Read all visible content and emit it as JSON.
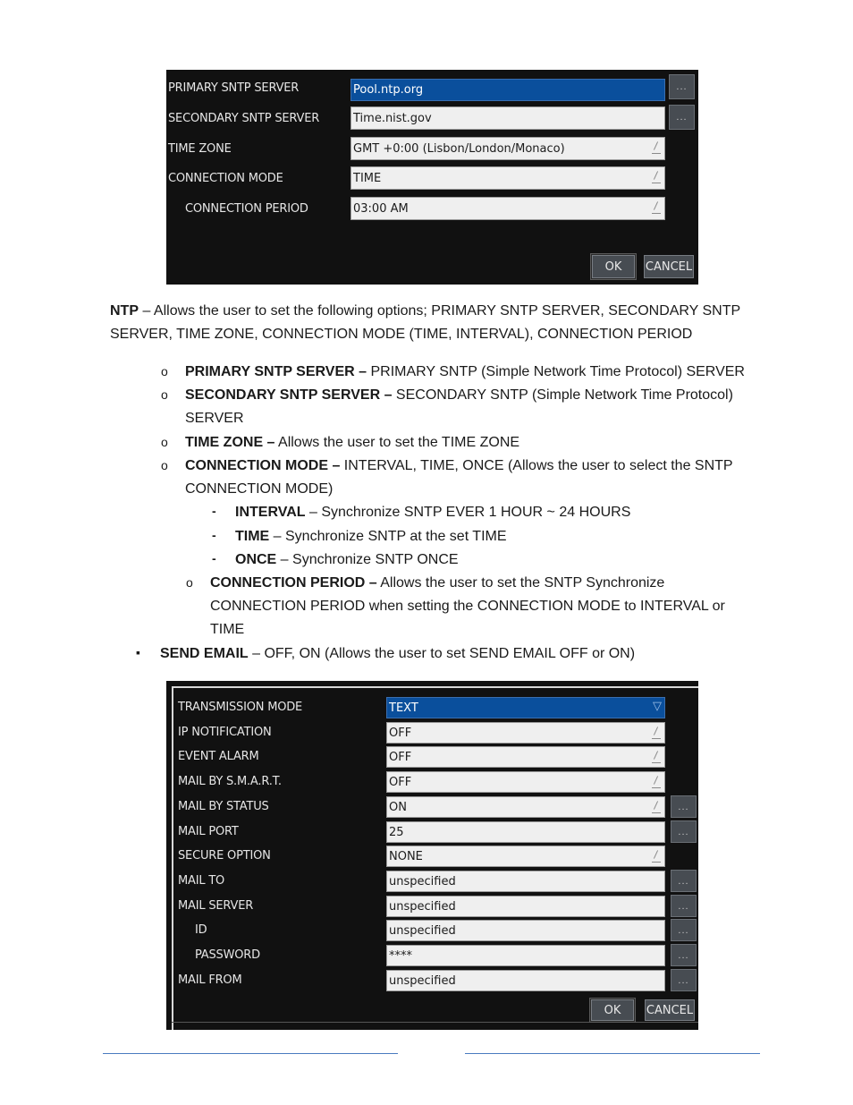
{
  "ntp_panel": {
    "rows": [
      {
        "label": "PRIMARY SNTP SERVER",
        "value": "Pool.ntp.org",
        "selected": true,
        "has_browse": true,
        "editable_mark": false
      },
      {
        "label": "SECONDARY SNTP SERVER",
        "value": "Time.nist.gov",
        "selected": false,
        "has_browse": true,
        "editable_mark": false
      },
      {
        "label": "TIME ZONE",
        "value": "GMT +0:00 (Lisbon/London/Monaco)",
        "selected": false,
        "has_browse": false,
        "editable_mark": true
      },
      {
        "label": "CONNECTION MODE",
        "value": "TIME",
        "selected": false,
        "has_browse": false,
        "editable_mark": true
      },
      {
        "label": "CONNECTION PERIOD",
        "value": "03:00 AM",
        "selected": false,
        "has_browse": false,
        "editable_mark": true
      }
    ],
    "browse_label": "...",
    "ok_label": "OK",
    "cancel_label": "CANCEL"
  },
  "description": {
    "ntp_term": "NTP",
    "ntp_text": " – Allows the user to set the following options; PRIMARY SNTP SERVER, SECONDARY SNTP SERVER, TIME ZONE, CONNECTION MODE (TIME, INTERVAL), CONNECTION PERIOD",
    "items": [
      {
        "term": "PRIMARY SNTP SERVER –",
        "text": " PRIMARY SNTP (Simple Network Time Protocol) SERVER"
      },
      {
        "term": "SECONDARY SNTP SERVER –",
        "text": " SECONDARY SNTP (Simple Network Time Protocol) SERVER"
      },
      {
        "term": "TIME ZONE –",
        "text": " Allows the user to set the TIME ZONE"
      },
      {
        "term": "CONNECTION MODE –",
        "text": " INTERVAL, TIME, ONCE (Allows the user to select the SNTP CONNECTION MODE)"
      }
    ],
    "mode_items": [
      {
        "term": "INTERVAL",
        "text": " – Synchronize SNTP EVER 1 HOUR ~ 24 HOURS"
      },
      {
        "term": "TIME",
        "text": " – Synchronize SNTP at the set TIME"
      },
      {
        "term": "ONCE",
        "text": " – Synchronize SNTP ONCE"
      }
    ],
    "period_item": {
      "term": "CONNECTION PERIOD –",
      "text": " Allows the user to set the SNTP Synchronize CONNECTION PERIOD when setting the CONNECTION MODE to INTERVAL or TIME"
    },
    "send_email": {
      "term": "SEND EMAIL",
      "text": " – OFF, ON (Allows the user to set SEND EMAIL OFF or ON)"
    },
    "bullet_circle": "o",
    "bullet_dash": "-",
    "bullet_square": "▪"
  },
  "email_panel": {
    "rows": [
      {
        "label": "TRANSMISSION MODE",
        "value": "TEXT",
        "selected": true,
        "has_browse": false,
        "mark": "dropdown"
      },
      {
        "label": "IP NOTIFICATION",
        "value": "OFF",
        "selected": false,
        "has_browse": false,
        "mark": "edit"
      },
      {
        "label": "EVENT ALARM",
        "value": "OFF",
        "selected": false,
        "has_browse": false,
        "mark": "edit"
      },
      {
        "label": "MAIL BY S.M.A.R.T.",
        "value": "OFF",
        "selected": false,
        "has_browse": false,
        "mark": "edit"
      },
      {
        "label": "MAIL BY STATUS",
        "value": "ON",
        "selected": false,
        "has_browse": true,
        "mark": "edit"
      },
      {
        "label": "MAIL PORT",
        "value": "25",
        "selected": false,
        "has_browse": true,
        "mark": "none"
      },
      {
        "label": "SECURE OPTION",
        "value": "NONE",
        "selected": false,
        "has_browse": false,
        "mark": "edit"
      },
      {
        "label": "MAIL TO",
        "value": "unspecified",
        "selected": false,
        "has_browse": true,
        "mark": "none"
      },
      {
        "label": "MAIL SERVER",
        "value": "unspecified",
        "selected": false,
        "has_browse": true,
        "mark": "none"
      },
      {
        "label": "ID",
        "value": "unspecified",
        "selected": false,
        "has_browse": true,
        "mark": "none"
      },
      {
        "label": "PASSWORD",
        "value": "****",
        "selected": false,
        "has_browse": true,
        "mark": "none"
      },
      {
        "label": "MAIL FROM",
        "value": "unspecified",
        "selected": false,
        "has_browse": true,
        "mark": "none"
      }
    ],
    "browse_label": "...",
    "ok_label": "OK",
    "cancel_label": "CANCEL"
  },
  "colors": {
    "selected_field": "#0a4f9c",
    "panel_bg": "#111111",
    "footer_rule": "#4a7bbf"
  }
}
